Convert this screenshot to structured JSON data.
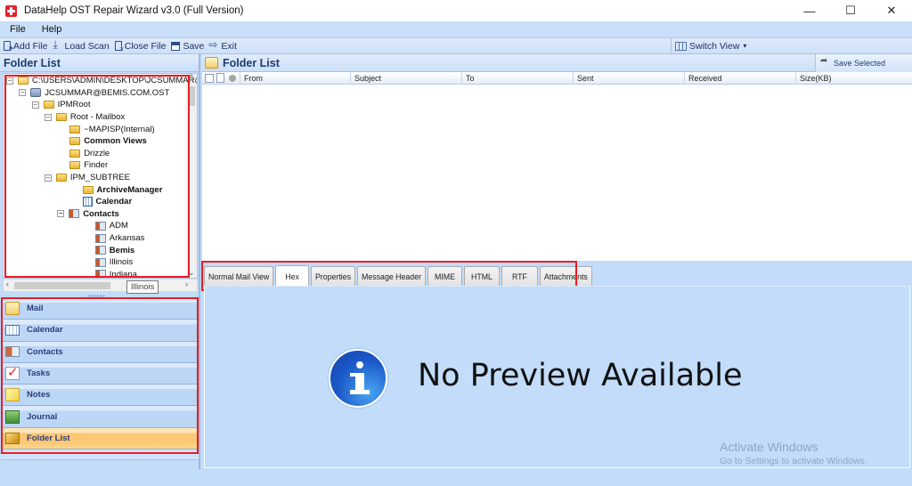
{
  "window": {
    "title": "DataHelp OST Repair Wizard v3.0 (Full Version)",
    "controls": {
      "minimize": "—",
      "maximize": "☐",
      "close": "✕"
    }
  },
  "menu": [
    "File",
    "Help"
  ],
  "toolbar": {
    "add_file": "Add File",
    "load_scan": "Load Scan",
    "close_file": "Close File",
    "save": "Save",
    "exit": "Exit",
    "switch_view": "Switch View",
    "switch_view_caret": "▾"
  },
  "left_pane": {
    "title": "Folder List",
    "tree": [
      {
        "label": "C:\\USERS\\ADMIN\\DESKTOP\\JCSUMMAR@E",
        "icon": "folder-open-icon",
        "expander": "−",
        "bold": false
      },
      {
        "label": "JCSUMMAR@BEMIS.COM.OST",
        "icon": "ost-file-icon",
        "expander": "−",
        "bold": false
      },
      {
        "label": "IPMRoot",
        "icon": "folder-icon",
        "expander": "−",
        "bold": false
      },
      {
        "label": "Root - Mailbox",
        "icon": "folder-icon",
        "expander": "−",
        "bold": false
      },
      {
        "label": "~MAPISP(Internal)",
        "icon": "folder-icon",
        "expander": "",
        "bold": false
      },
      {
        "label": "Common Views",
        "icon": "folder-icon",
        "expander": "",
        "bold": true
      },
      {
        "label": "Drizzle",
        "icon": "folder-icon",
        "expander": "",
        "bold": false
      },
      {
        "label": "Finder",
        "icon": "folder-icon",
        "expander": "",
        "bold": false
      },
      {
        "label": "IPM_SUBTREE",
        "icon": "folder-icon",
        "expander": "−",
        "bold": false
      },
      {
        "label": "ArchiveManager",
        "icon": "folder-icon",
        "expander": "",
        "bold": true
      },
      {
        "label": "Calendar",
        "icon": "calendar-icon",
        "expander": "",
        "bold": true
      },
      {
        "label": "Contacts",
        "icon": "contacts-icon",
        "expander": "−",
        "bold": true
      },
      {
        "label": "ADM",
        "icon": "contacts-icon",
        "expander": "",
        "bold": false
      },
      {
        "label": "Arkansas",
        "icon": "contacts-icon",
        "expander": "",
        "bold": false
      },
      {
        "label": "Bemis",
        "icon": "contacts-icon",
        "expander": "",
        "bold": true
      },
      {
        "label": "Illinois",
        "icon": "contacts-icon",
        "expander": "",
        "bold": false
      },
      {
        "label": "Indiana",
        "icon": "contacts-icon",
        "expander": "",
        "bold": false
      }
    ],
    "tooltip": "Illinois",
    "splitter": "••••••",
    "nav": [
      {
        "label": "Mail",
        "icon": "mail-icon",
        "active": false
      },
      {
        "label": "Calendar",
        "icon": "calendar-icon",
        "active": false
      },
      {
        "label": "Contacts",
        "icon": "contacts-icon",
        "active": false
      },
      {
        "label": "Tasks",
        "icon": "tasks-icon",
        "active": false
      },
      {
        "label": "Notes",
        "icon": "notes-icon",
        "active": false
      },
      {
        "label": "Journal",
        "icon": "journal-icon",
        "active": false
      },
      {
        "label": "Folder List",
        "icon": "folder-list-icon",
        "active": true
      }
    ]
  },
  "right_pane": {
    "title": "Folder List",
    "save_selected": "Save Selected",
    "columns": [
      "From",
      "Subject",
      "To",
      "Sent",
      "Received",
      "Size(KB)"
    ],
    "rows": [],
    "tabs": [
      {
        "label": "Normal Mail View",
        "active": false
      },
      {
        "label": "Hex",
        "active": true
      },
      {
        "label": "Properties",
        "active": false
      },
      {
        "label": "Message Header",
        "active": false
      },
      {
        "label": "MIME",
        "active": false
      },
      {
        "label": "HTML",
        "active": false
      },
      {
        "label": "RTF",
        "active": false
      },
      {
        "label": "Attachments",
        "active": false
      }
    ],
    "preview_message": "No Preview Available"
  },
  "watermark": {
    "line1": "Activate Windows",
    "line2": "Go to Settings to activate Windows."
  },
  "colors": {
    "highlight_box": "#e81d24",
    "panel_bg": "#c2dcfa",
    "header_text": "#1e3b70",
    "active_nav": "#fcc876"
  }
}
